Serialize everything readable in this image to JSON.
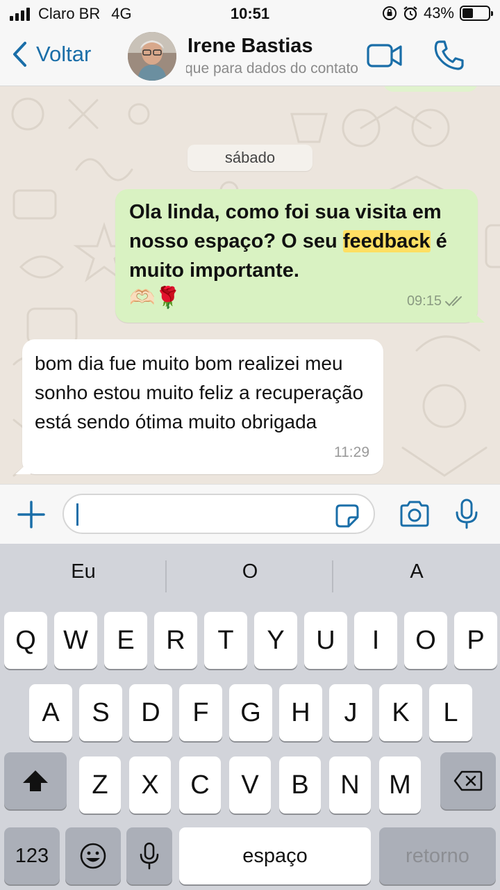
{
  "status_bar": {
    "carrier": "Claro BR",
    "network": "4G",
    "time": "10:51",
    "battery": "43%",
    "battery_level": 0.43,
    "icons": [
      "signal-icon",
      "orientation-lock-icon",
      "alarm-icon",
      "battery-icon"
    ]
  },
  "header": {
    "back_label": "Voltar",
    "contact_name": "Irene Bastias",
    "contact_subtitle": "toque para dados do contato",
    "icons": [
      "chevron-left-icon",
      "video-call-icon",
      "phone-icon"
    ]
  },
  "chat": {
    "date_label": "sábado",
    "messages": [
      {
        "direction": "outgoing",
        "text_before": "Ola linda, como foi sua visita em nosso espaço? O seu ",
        "highlight": "feedback",
        "text_after": " é muito importante.",
        "emojis": "🫶🏻🌹",
        "time": "09:15",
        "status": "read-check-icon"
      },
      {
        "direction": "incoming",
        "text": "bom dia fue muito bom realizei meu sonho estou muito feliz a recuperação está sendo ótima muito obrigada",
        "time": "11:29"
      }
    ]
  },
  "input_bar": {
    "value": "",
    "icons": [
      "plus-icon",
      "sticker-icon",
      "camera-icon",
      "microphone-icon"
    ]
  },
  "keyboard": {
    "suggestions": [
      "Eu",
      "O",
      "A"
    ],
    "row1": [
      "Q",
      "W",
      "E",
      "R",
      "T",
      "Y",
      "U",
      "I",
      "O",
      "P"
    ],
    "row2": [
      "A",
      "S",
      "D",
      "F",
      "G",
      "H",
      "J",
      "K",
      "L"
    ],
    "row3": [
      "Z",
      "X",
      "C",
      "V",
      "B",
      "N",
      "M"
    ],
    "numbers_label": "123",
    "space_label": "espaço",
    "return_label": "retorno",
    "icons": [
      "shift-icon",
      "backspace-icon",
      "emoji-icon",
      "dictation-mic-icon"
    ]
  },
  "colors": {
    "accent": "#1a6ea8",
    "outgoing_bubble": "#d9f2c2",
    "incoming_bubble": "#ffffff",
    "chat_background": "#ece5dd",
    "highlight": "#ffdf63",
    "keyboard_background": "#d2d4da"
  }
}
